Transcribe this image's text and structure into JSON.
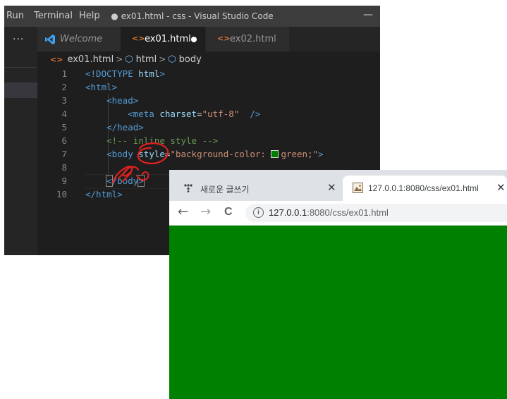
{
  "vscode": {
    "menu": [
      "Run",
      "Terminal",
      "Help"
    ],
    "window_title": "● ex01.html - css - Visual Studio Code",
    "minimize": "—",
    "activity_ellipsis": "···",
    "tabs": [
      {
        "label": "Welcome",
        "icon": "vscode-logo-icon"
      },
      {
        "label": "ex01.html",
        "icon": "html-file-icon",
        "dirty": true
      },
      {
        "label": "ex02.html",
        "icon": "html-file-icon"
      }
    ],
    "breadcrumb": [
      "ex01.html",
      "html",
      "body"
    ],
    "code_lines": [
      {
        "n": "1",
        "tokens": [
          [
            "<!DOCTYPE ",
            "tag"
          ],
          [
            "html",
            "attr"
          ],
          [
            ">",
            "tag"
          ]
        ]
      },
      {
        "n": "2",
        "tokens": [
          [
            "<html>",
            "tag"
          ]
        ]
      },
      {
        "n": "3",
        "tokens": [
          [
            "    <head>",
            "tag"
          ]
        ]
      },
      {
        "n": "4",
        "tokens": [
          [
            "        <meta ",
            "tag"
          ],
          [
            "charset",
            "attr"
          ],
          [
            "=",
            "text"
          ],
          [
            "\"utf-8\"",
            "str"
          ],
          [
            "  />",
            "tag"
          ]
        ]
      },
      {
        "n": "5",
        "tokens": [
          [
            "    </head>",
            "tag"
          ]
        ]
      },
      {
        "n": "6",
        "tokens": [
          [
            "    <!-- inline style -->",
            "comment"
          ]
        ]
      },
      {
        "n": "7",
        "tokens": [
          [
            "    <body ",
            "tag"
          ],
          [
            "style",
            "attr"
          ],
          [
            "=",
            "text"
          ],
          [
            "\"background-color: ",
            "str"
          ],
          [
            "",
            "swatch"
          ],
          [
            "green;\"",
            "str"
          ],
          [
            ">",
            "tag"
          ]
        ]
      },
      {
        "n": "8",
        "tokens": []
      },
      {
        "n": "9",
        "tokens": [
          [
            "    ",
            "text"
          ],
          [
            "<",
            "tag-box"
          ],
          [
            "/body",
            "tag"
          ],
          [
            ">",
            "tag-box"
          ]
        ]
      },
      {
        "n": "10",
        "tokens": [
          [
            "</html>",
            "tag"
          ]
        ]
      }
    ]
  },
  "browser": {
    "tabs": [
      {
        "label": "새로운 글쓰기",
        "icon": "dots-favicon-icon"
      },
      {
        "label": "127.0.0.1:8080/css/ex01.html",
        "icon": "image-favicon-icon"
      }
    ],
    "close_glyph": "✕",
    "nav": {
      "back": "←",
      "forward": "→",
      "reload": "C"
    },
    "info_glyph": "i",
    "url_host": "127.0.0.1",
    "url_rest": ":8080/css/ex01.html",
    "page_background": "#008000"
  },
  "colors": {
    "annotation": "#e02020",
    "editor_bg": "#1e1e1e",
    "accent_html": "#e37933"
  }
}
